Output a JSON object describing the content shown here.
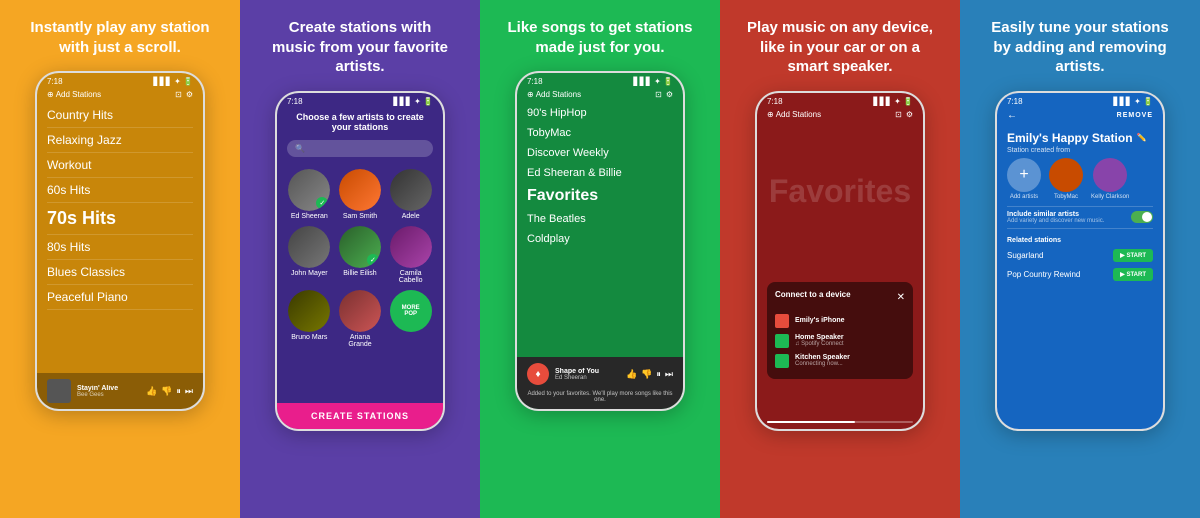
{
  "panels": [
    {
      "id": "panel-1",
      "tagline": "Instantly play any station with just a scroll.",
      "bg": "#F5A623",
      "phone": {
        "header": "Add Stations",
        "time": "7:18",
        "stations": [
          {
            "name": "Country Hits",
            "large": false
          },
          {
            "name": "Relaxing Jazz",
            "large": false
          },
          {
            "name": "Workout",
            "large": false
          },
          {
            "name": "60s Hits",
            "large": false
          },
          {
            "name": "70s Hits",
            "large": true
          },
          {
            "name": "80s Hits",
            "large": false
          },
          {
            "name": "Blues Classics",
            "large": false
          },
          {
            "name": "Peaceful Piano",
            "large": false
          }
        ],
        "nowPlaying": {
          "title": "Stayin' Alive",
          "artist": "Bee Gees"
        }
      }
    },
    {
      "id": "panel-2",
      "tagline": "Create stations with music from your favorite artists.",
      "bg": "#5B3FA6",
      "phone": {
        "time": "7:18",
        "prompt": "Choose a few artists to create your stations",
        "artists": [
          {
            "name": "Ed Sheeran",
            "color": "#888"
          },
          {
            "name": "Sam Smith",
            "color": "#c84b00"
          },
          {
            "name": "Adele",
            "color": "#555"
          },
          {
            "name": "John Mayer",
            "color": "#666"
          },
          {
            "name": "Billie Eilish",
            "color": "#2a6f2a"
          },
          {
            "name": "Camila Cabello",
            "color": "#8844aa"
          },
          {
            "name": "Bruno Mars",
            "color": "#555500"
          },
          {
            "name": "Ariana Grande",
            "color": "#bb4444"
          },
          {
            "name": "MORE POP",
            "special": true
          }
        ],
        "createBtn": "CREATE STATIONS"
      }
    },
    {
      "id": "panel-3",
      "tagline": "Like songs to get stations made just for you.",
      "bg": "#1DB954",
      "phone": {
        "time": "7:18",
        "header": "Add Stations",
        "stations": [
          {
            "name": "90's HipHop",
            "large": false
          },
          {
            "name": "TobyMac",
            "large": false
          },
          {
            "name": "Discover Weekly",
            "large": false
          },
          {
            "name": "Ed Sheeran & Billie",
            "large": false
          },
          {
            "name": "Favorites",
            "large": true
          },
          {
            "name": "The Beatles",
            "large": false
          },
          {
            "name": "Coldplay",
            "large": false
          }
        ],
        "nowPlaying": {
          "title": "Shape of You",
          "artist": "Ed Sheeran"
        },
        "likedMsg": "Added to your favorites. We'll play more songs like this one."
      }
    },
    {
      "id": "panel-4",
      "tagline": "Play music on any device, like in your car or on a smart speaker.",
      "bg": "#C0392B",
      "phone": {
        "time": "7:18",
        "bgText": "Favorites",
        "connectTitle": "Connect to a device",
        "devices": [
          {
            "name": "Emily's iPhone",
            "sub": ""
          },
          {
            "name": "Home Speaker",
            "sub": "♫ Spotify Connect"
          },
          {
            "name": "Kitchen Speaker",
            "sub": "Connecting now..."
          }
        ]
      }
    },
    {
      "id": "panel-5",
      "tagline": "Easily tune your stations by adding and removing artists.",
      "bg": "#2980B9",
      "phone": {
        "time": "7:18",
        "removeLabel": "REMOVE",
        "stationName": "Emily's Happy Station",
        "stationCreatedFrom": "Station created from",
        "artists": [
          {
            "name": "TobyMac",
            "color": "#c84b00"
          },
          {
            "name": "Kelly Clarkson",
            "color": "#6a1a6a"
          }
        ],
        "similarLabel": "Include similar artists",
        "similarSub": "Add variety and discover new music.",
        "relatedTitle": "Related stations",
        "relatedStations": [
          {
            "name": "Sugarland",
            "btn": "START"
          },
          {
            "name": "Pop Country Rewind",
            "btn": "START"
          }
        ]
      }
    }
  ]
}
